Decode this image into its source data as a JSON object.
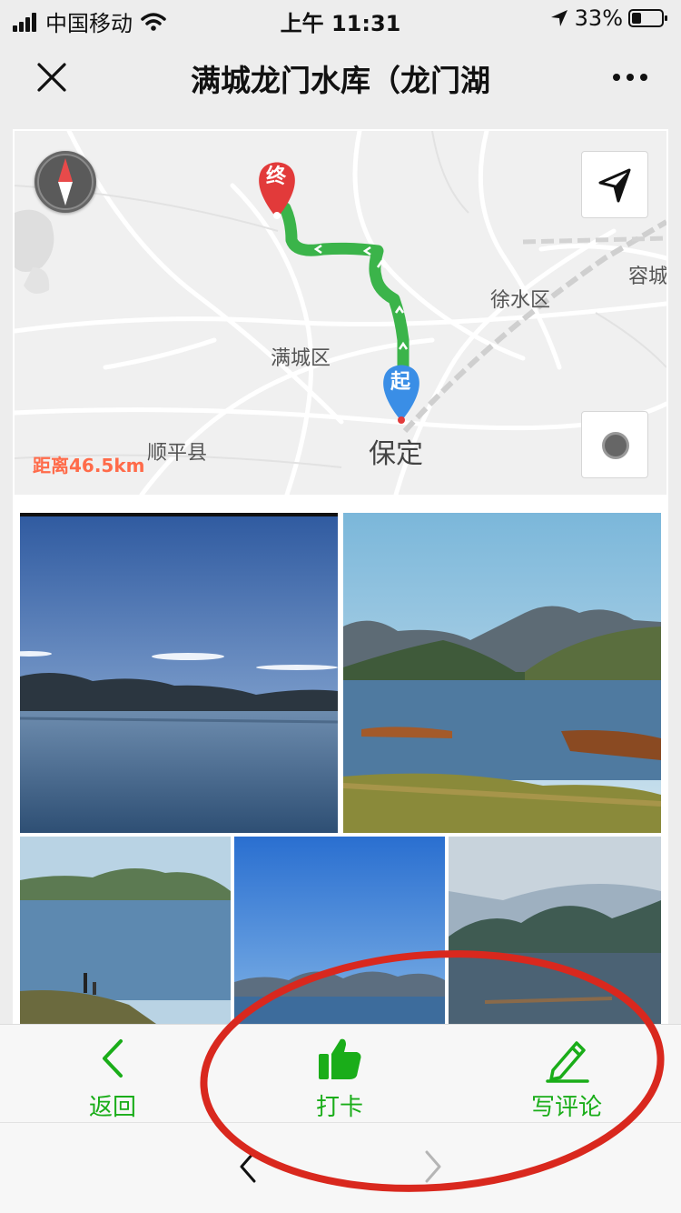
{
  "status_bar": {
    "carrier": "中国移动",
    "time": "上午 11:31",
    "battery": "33%"
  },
  "nav": {
    "title": "满城龙门水库（龙门湖"
  },
  "map": {
    "labels": {
      "end_marker": "终",
      "start_marker": "起",
      "district_xushui": "徐水区",
      "district_mancheng": "满城区",
      "county_shunping": "顺平县",
      "city_baoding": "保定",
      "rongcheng": "容城"
    },
    "distance": "距离46.5km",
    "route_color": "#3bb44a"
  },
  "actions": {
    "back_label": "返回",
    "checkin_label": "打卡",
    "comment_label": "写评论",
    "accent_color": "#1aad19"
  },
  "icons": {
    "close": "close-icon",
    "more": "more-icon",
    "compass": "compass-icon",
    "locate": "location-arrow-icon",
    "record": "record-icon",
    "back": "chevron-left-icon",
    "thumb": "thumbs-up-icon",
    "pencil": "pencil-icon",
    "browser_back": "browser-back-icon",
    "browser_forward": "browser-forward-icon"
  }
}
